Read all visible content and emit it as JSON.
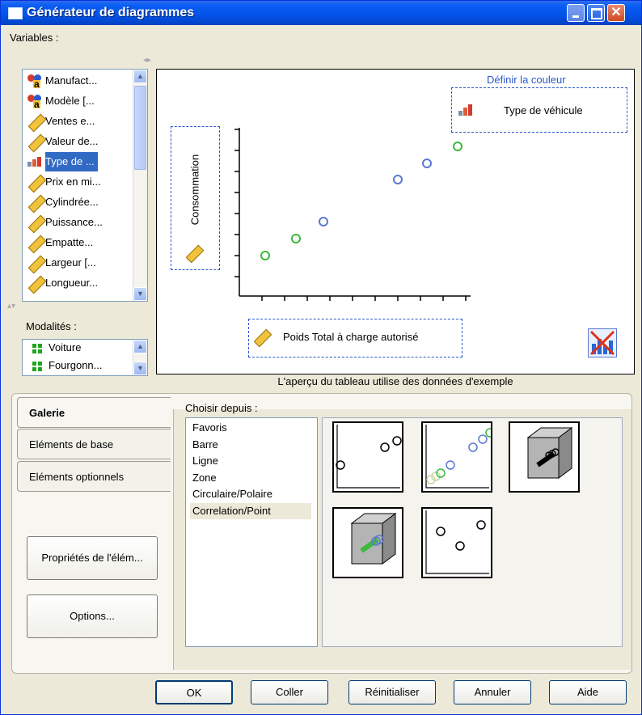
{
  "window": {
    "title": "Générateur de diagrammes"
  },
  "variables": {
    "label": "Variables :",
    "items": [
      {
        "label": "Manufact...",
        "icon": "nominal-icon"
      },
      {
        "label": "Modèle [...",
        "icon": "nominal-icon"
      },
      {
        "label": "Ventes e...",
        "icon": "scale-icon"
      },
      {
        "label": "Valeur de...",
        "icon": "scale-icon"
      },
      {
        "label": "Type de ...",
        "icon": "ordinal-icon",
        "selected": true
      },
      {
        "label": "Prix en mi...",
        "icon": "scale-icon"
      },
      {
        "label": "Cylindrée...",
        "icon": "scale-icon"
      },
      {
        "label": "Puissance...",
        "icon": "scale-icon"
      },
      {
        "label": "Empatte...",
        "icon": "scale-icon"
      },
      {
        "label": "Largeur [...",
        "icon": "scale-icon"
      },
      {
        "label": "Longueur...",
        "icon": "scale-icon"
      }
    ]
  },
  "categories": {
    "label": "Modalités :",
    "items": [
      "Voiture",
      "Fourgonn..."
    ]
  },
  "canvas": {
    "color_zone_label": "Définir la couleur",
    "color_var": "Type de véhicule",
    "y_var": "Consommation",
    "x_var": "Poids Total à charge autorisé",
    "caption": "L'aperçu du tableau utilise des données d'exemple"
  },
  "tabs": [
    "Galerie",
    "Eléments de base",
    "Eléments optionnels"
  ],
  "buttons": {
    "properties": "Propriétés de l'élém...",
    "options": "Options..."
  },
  "gallery": {
    "choose_label": "Choisir depuis :",
    "types": [
      "Favoris",
      "Barre",
      "Ligne",
      "Zone",
      "Circulaire/Polaire",
      "Correlation/Point"
    ],
    "selected_type": "Correlation/Point"
  },
  "footer": {
    "ok": "OK",
    "paste": "Coller",
    "reset": "Réinitialiser",
    "cancel": "Annuler",
    "help": "Aide"
  },
  "colors": {
    "green": "#3cb83c",
    "blue": "#5a78d0",
    "accent": "#316ac5"
  }
}
